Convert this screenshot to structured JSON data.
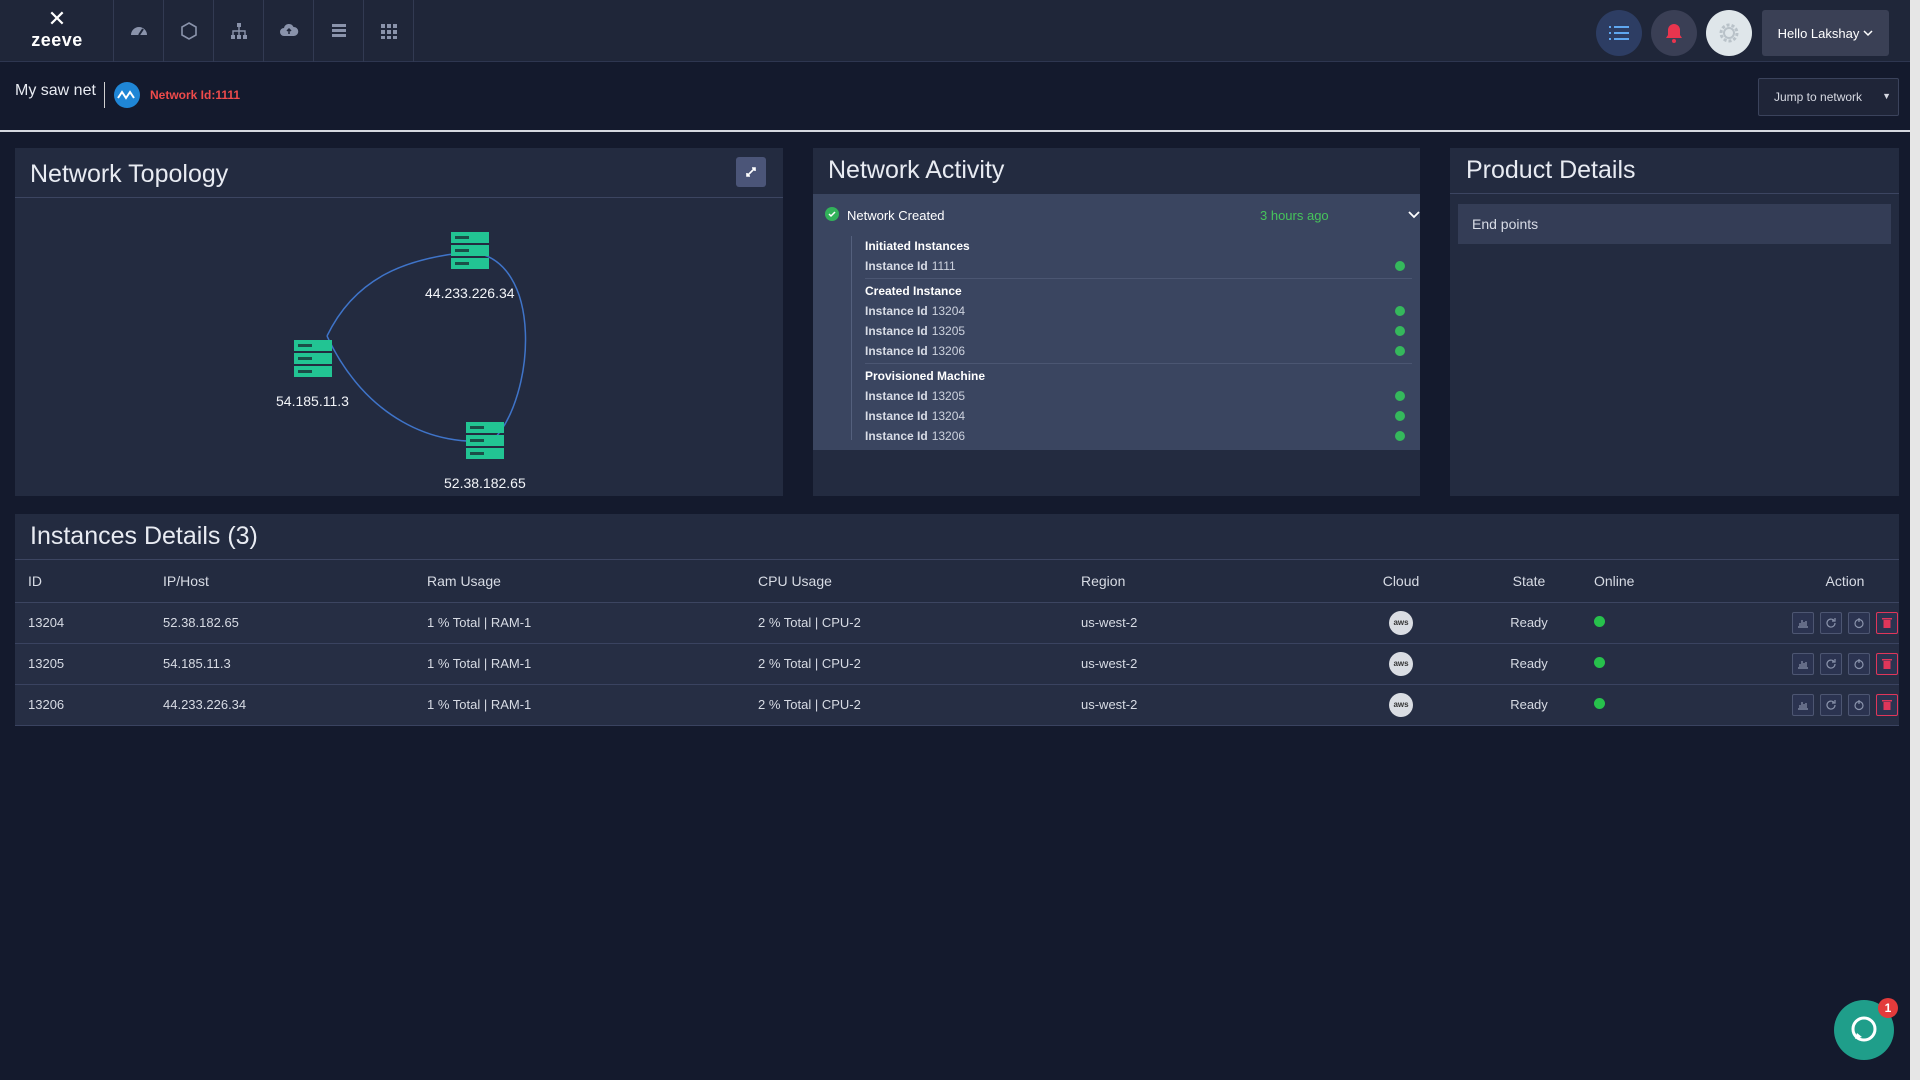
{
  "brand": {
    "name": "zeeve"
  },
  "nav": {
    "icons": [
      "dashboard-icon",
      "hexagon-icon",
      "network-tree-icon",
      "cloud-upload-icon",
      "server-list-icon",
      "apps-grid-icon"
    ]
  },
  "header_right": {
    "user_label": "Hello Lakshay"
  },
  "subheader": {
    "network_name": "My saw net",
    "network_id": "Network Id:1111",
    "jump_placeholder": "Jump to network"
  },
  "topology": {
    "title": "Network Topology",
    "nodes": [
      "44.233.226.34",
      "54.185.11.3",
      "52.38.182.65"
    ]
  },
  "activity": {
    "title": "Network Activity",
    "event": "Network Created",
    "time": "3 hours ago",
    "groups": [
      {
        "title": "Initiated Instances",
        "rows": [
          {
            "label": "Instance Id",
            "value": "1111"
          }
        ]
      },
      {
        "title": "Created Instance",
        "rows": [
          {
            "label": "Instance Id",
            "value": "13204"
          },
          {
            "label": "Instance Id",
            "value": "13205"
          },
          {
            "label": "Instance Id",
            "value": "13206"
          }
        ]
      },
      {
        "title": "Provisioned Machine",
        "rows": [
          {
            "label": "Instance Id",
            "value": "13205"
          },
          {
            "label": "Instance Id",
            "value": "13204"
          },
          {
            "label": "Instance Id",
            "value": "13206"
          }
        ]
      }
    ]
  },
  "product": {
    "title": "Product Details",
    "endpoints_label": "End points"
  },
  "instances": {
    "title": "Instances Details (3)",
    "columns": [
      "ID",
      "IP/Host",
      "Ram Usage",
      "CPU Usage",
      "Region",
      "Cloud",
      "State",
      "Online",
      "Action"
    ],
    "rows": [
      {
        "id": "13204",
        "ip": "52.38.182.65",
        "ram": "1 % Total | RAM-1",
        "cpu": "2 % Total | CPU-2",
        "region": "us-west-2",
        "cloud": "aws",
        "state": "Ready"
      },
      {
        "id": "13205",
        "ip": "54.185.11.3",
        "ram": "1 % Total | RAM-1",
        "cpu": "2 % Total | CPU-2",
        "region": "us-west-2",
        "cloud": "aws",
        "state": "Ready"
      },
      {
        "id": "13206",
        "ip": "44.233.226.34",
        "ram": "1 % Total | RAM-1",
        "cpu": "2 % Total | CPU-2",
        "region": "us-west-2",
        "cloud": "aws",
        "state": "Ready"
      }
    ]
  },
  "chat": {
    "badge": "1"
  },
  "colors": {
    "accent_green": "#32b25a",
    "danger": "#e0365a",
    "network_id": "#ef4b4b",
    "node": "#22c493"
  }
}
